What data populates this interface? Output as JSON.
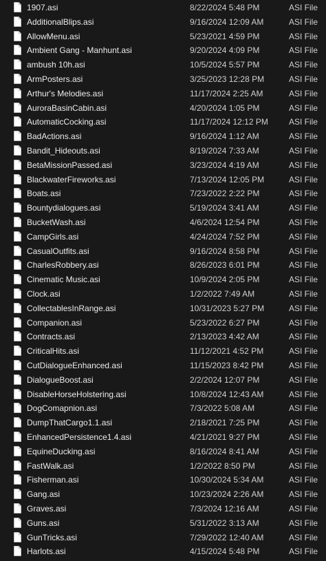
{
  "files": [
    {
      "name": "1907.asi",
      "modified": "8/22/2024 5:48 PM",
      "type": "ASI File"
    },
    {
      "name": "AdditionalBlips.asi",
      "modified": "9/16/2024 12:09 AM",
      "type": "ASI File"
    },
    {
      "name": "AllowMenu.asi",
      "modified": "5/23/2021 4:59 PM",
      "type": "ASI File"
    },
    {
      "name": "Ambient Gang - Manhunt.asi",
      "modified": "9/20/2024 4:09 PM",
      "type": "ASI File"
    },
    {
      "name": "ambush 10h.asi",
      "modified": "10/5/2024 5:57 PM",
      "type": "ASI File"
    },
    {
      "name": "ArmPosters.asi",
      "modified": "3/25/2023 12:28 PM",
      "type": "ASI File"
    },
    {
      "name": "Arthur's Melodies.asi",
      "modified": "11/17/2024 2:25 AM",
      "type": "ASI File"
    },
    {
      "name": "AuroraBasinCabin.asi",
      "modified": "4/20/2024 1:05 PM",
      "type": "ASI File"
    },
    {
      "name": "AutomaticCocking.asi",
      "modified": "11/17/2024 12:12 PM",
      "type": "ASI File"
    },
    {
      "name": "BadActions.asi",
      "modified": "9/16/2024 1:12 AM",
      "type": "ASI File"
    },
    {
      "name": "Bandit_Hideouts.asi",
      "modified": "8/19/2024 7:33 AM",
      "type": "ASI File"
    },
    {
      "name": "BetaMissionPassed.asi",
      "modified": "3/23/2024 4:19 AM",
      "type": "ASI File"
    },
    {
      "name": "BlackwaterFireworks.asi",
      "modified": "7/13/2024 12:05 PM",
      "type": "ASI File"
    },
    {
      "name": "Boats.asi",
      "modified": "7/23/2022 2:22 PM",
      "type": "ASI File"
    },
    {
      "name": "Bountydialogues.asi",
      "modified": "5/19/2024 3:41 AM",
      "type": "ASI File"
    },
    {
      "name": "BucketWash.asi",
      "modified": "4/6/2024 12:54 PM",
      "type": "ASI File"
    },
    {
      "name": "CampGirls.asi",
      "modified": "4/24/2024 7:52 PM",
      "type": "ASI File"
    },
    {
      "name": "CasualOutfits.asi",
      "modified": "9/16/2024 8:58 PM",
      "type": "ASI File"
    },
    {
      "name": "CharlesRobbery.asi",
      "modified": "8/26/2023 6:01 PM",
      "type": "ASI File"
    },
    {
      "name": "Cinematic Music.asi",
      "modified": "10/9/2024 2:05 PM",
      "type": "ASI File"
    },
    {
      "name": "Clock.asi",
      "modified": "1/2/2022 7:49 AM",
      "type": "ASI File"
    },
    {
      "name": "CollectablesInRange.asi",
      "modified": "10/31/2023 5:27 PM",
      "type": "ASI File"
    },
    {
      "name": "Companion.asi",
      "modified": "5/23/2022 6:27 PM",
      "type": "ASI File"
    },
    {
      "name": "Contracts.asi",
      "modified": "2/13/2023 4:42 AM",
      "type": "ASI File"
    },
    {
      "name": "CriticalHits.asi",
      "modified": "11/12/2021 4:52 PM",
      "type": "ASI File"
    },
    {
      "name": "CutDialogueEnhanced.asi",
      "modified": "11/15/2023 8:42 PM",
      "type": "ASI File"
    },
    {
      "name": "DialogueBoost.asi",
      "modified": "2/2/2024 12:07 PM",
      "type": "ASI File"
    },
    {
      "name": "DisableHorseHolstering.asi",
      "modified": "10/8/2024 12:43 AM",
      "type": "ASI File"
    },
    {
      "name": "DogComapnion.asi",
      "modified": "7/3/2022 5:08 AM",
      "type": "ASI File"
    },
    {
      "name": "DumpThatCargo1.1.asi",
      "modified": "2/18/2021 7:25 PM",
      "type": "ASI File"
    },
    {
      "name": "EnhancedPersistence1.4.asi",
      "modified": "4/21/2021 9:27 PM",
      "type": "ASI File"
    },
    {
      "name": "EquineDucking.asi",
      "modified": "8/16/2024 8:41 AM",
      "type": "ASI File"
    },
    {
      "name": "FastWalk.asi",
      "modified": "1/2/2022 8:50 PM",
      "type": "ASI File"
    },
    {
      "name": "Fisherman.asi",
      "modified": "10/30/2024 5:34 AM",
      "type": "ASI File"
    },
    {
      "name": "Gang.asi",
      "modified": "10/23/2024 2:26 AM",
      "type": "ASI File"
    },
    {
      "name": "Graves.asi",
      "modified": "7/3/2024 12:16 AM",
      "type": "ASI File"
    },
    {
      "name": "Guns.asi",
      "modified": "5/31/2022 3:13 AM",
      "type": "ASI File"
    },
    {
      "name": "GunTricks.asi",
      "modified": "7/29/2022 12:40 AM",
      "type": "ASI File"
    },
    {
      "name": "Harlots.asi",
      "modified": "4/15/2024 5:48 PM",
      "type": "ASI File"
    }
  ]
}
